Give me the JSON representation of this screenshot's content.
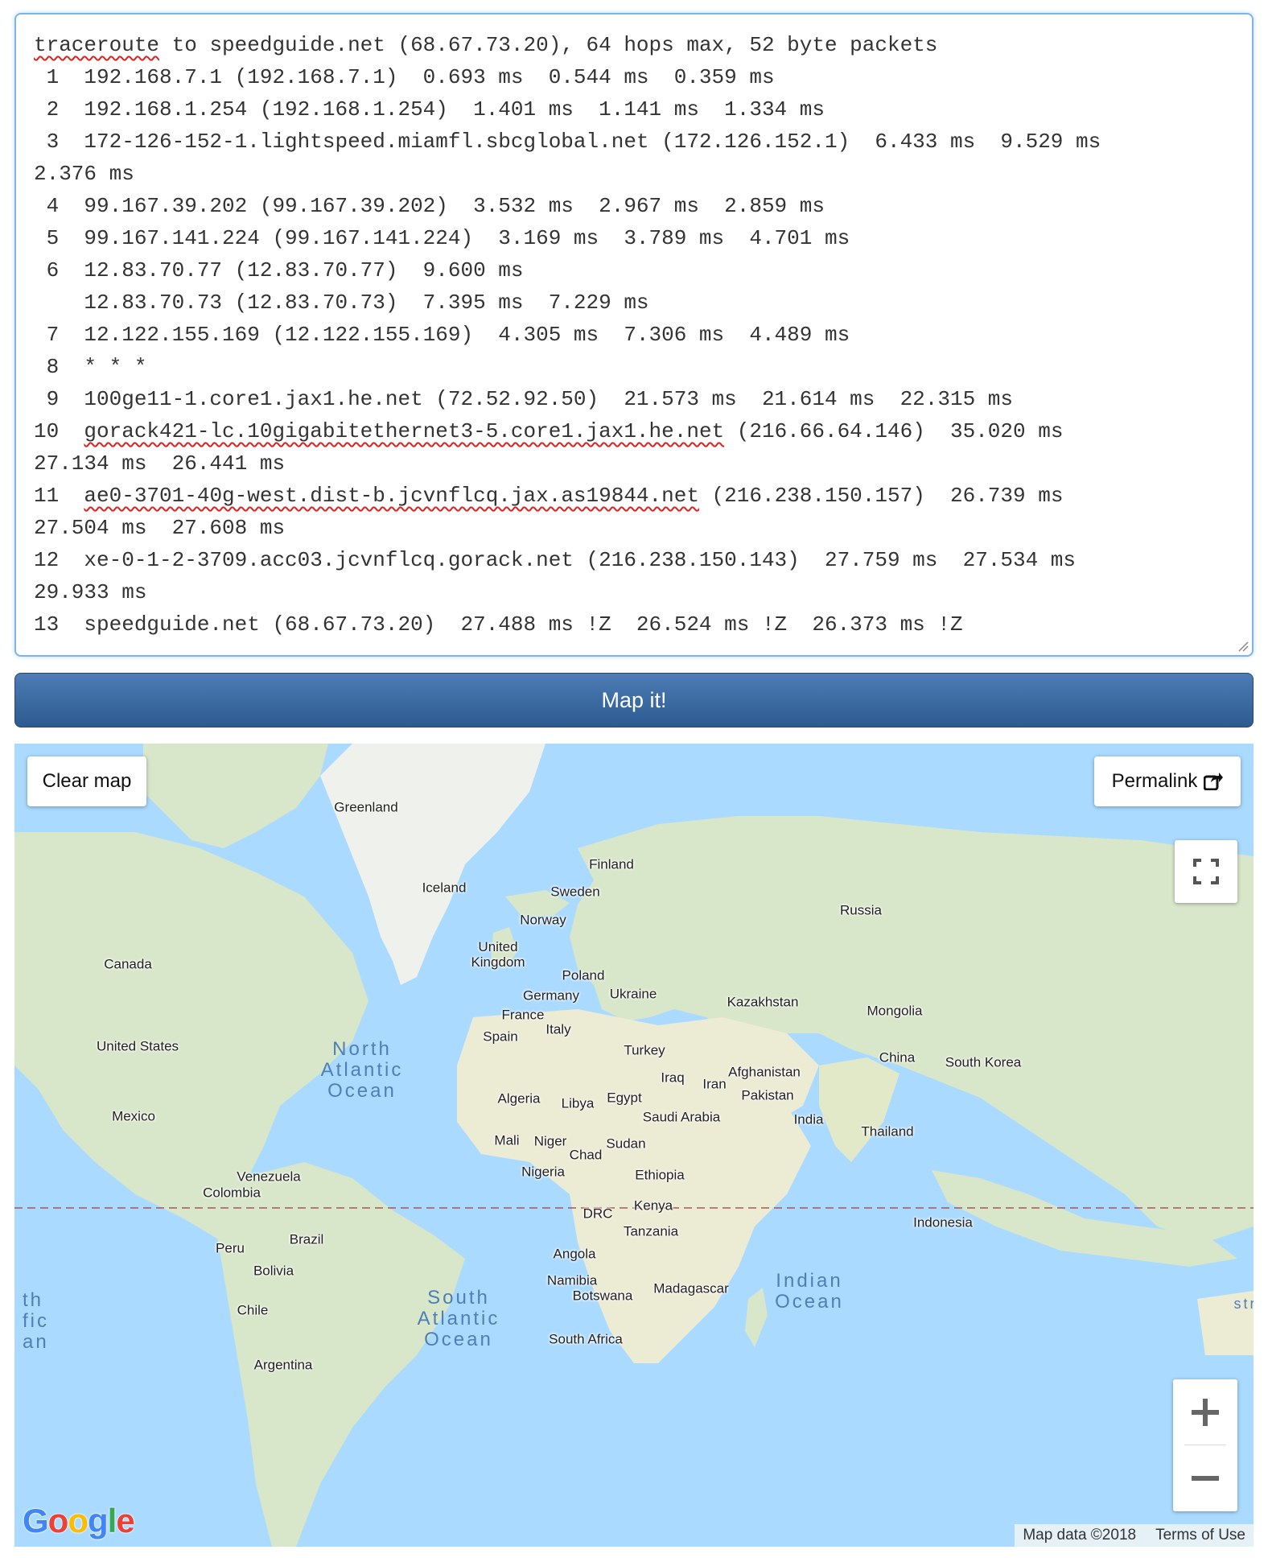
{
  "traceroute": {
    "lines": [
      {
        "lead": "",
        "squiggle": "traceroute",
        "tail": " to speedguide.net (68.67.73.20), 64 hops max, 52 byte packets"
      },
      {
        "lead": "",
        "squiggle": "",
        "tail": " 1  192.168.7.1 (192.168.7.1)  0.693 ms  0.544 ms  0.359 ms"
      },
      {
        "lead": "",
        "squiggle": "",
        "tail": " 2  192.168.1.254 (192.168.1.254)  1.401 ms  1.141 ms  1.334 ms"
      },
      {
        "lead": "",
        "squiggle": "",
        "tail": " 3  172-126-152-1.lightspeed.miamfl.sbcglobal.net (172.126.152.1)  6.433 ms  9.529 ms"
      },
      {
        "lead": "",
        "squiggle": "",
        "tail": "2.376 ms"
      },
      {
        "lead": "",
        "squiggle": "",
        "tail": " 4  99.167.39.202 (99.167.39.202)  3.532 ms  2.967 ms  2.859 ms"
      },
      {
        "lead": "",
        "squiggle": "",
        "tail": " 5  99.167.141.224 (99.167.141.224)  3.169 ms  3.789 ms  4.701 ms"
      },
      {
        "lead": "",
        "squiggle": "",
        "tail": " 6  12.83.70.77 (12.83.70.77)  9.600 ms"
      },
      {
        "lead": "",
        "squiggle": "",
        "tail": "    12.83.70.73 (12.83.70.73)  7.395 ms  7.229 ms"
      },
      {
        "lead": "",
        "squiggle": "",
        "tail": " 7  12.122.155.169 (12.122.155.169)  4.305 ms  7.306 ms  4.489 ms"
      },
      {
        "lead": "",
        "squiggle": "",
        "tail": " 8  * * *"
      },
      {
        "lead": "",
        "squiggle": "",
        "tail": " 9  100ge11-1.core1.jax1.he.net (72.52.92.50)  21.573 ms  21.614 ms  22.315 ms"
      },
      {
        "lead": "10  ",
        "squiggle": "gorack421-lc.10gigabitethernet3-5.core1.jax1.he.net",
        "tail": " (216.66.64.146)  35.020 ms"
      },
      {
        "lead": "",
        "squiggle": "",
        "tail": "27.134 ms  26.441 ms"
      },
      {
        "lead": "11  ",
        "squiggle": "ae0-3701-40g-west.dist-b.jcvnflcq.jax.as19844.net",
        "tail": " (216.238.150.157)  26.739 ms"
      },
      {
        "lead": "",
        "squiggle": "",
        "tail": "27.504 ms  27.608 ms"
      },
      {
        "lead": "",
        "squiggle": "",
        "tail": "12  xe-0-1-2-3709.acc03.jcvnflcq.gorack.net (216.238.150.143)  27.759 ms  27.534 ms"
      },
      {
        "lead": "",
        "squiggle": "",
        "tail": "29.933 ms"
      },
      {
        "lead": "",
        "squiggle": "",
        "tail": "13  speedguide.net (68.67.73.20)  27.488 ms !Z  26.524 ms !Z  26.373 ms !Z"
      }
    ]
  },
  "map_button_label": "Map it!",
  "map": {
    "clear_label": "Clear map",
    "permalink_label": "Permalink",
    "zoom_in_label": "+",
    "zoom_out_label": "−",
    "attribution_data": "Map data ©2018",
    "attribution_terms": "Terms of Use",
    "google_logo": "Google",
    "colors": {
      "water": "#aadaff",
      "land": "#d9e8c4",
      "equator": "#a05050"
    },
    "place_labels": [
      "Greenland",
      "Iceland",
      "Finland",
      "Sweden",
      "Norway",
      "Russia",
      "United\nKingdom",
      "Poland",
      "Germany",
      "Ukraine",
      "France",
      "Kazakhstan",
      "Mongolia",
      "Spain",
      "Italy",
      "Turkey",
      "China",
      "South Korea",
      "Afghanistan",
      "Iraq",
      "Iran",
      "Pakistan",
      "Algeria",
      "Libya",
      "Egypt",
      "Saudi Arabia",
      "India",
      "Thailand",
      "Mali",
      "Niger",
      "Chad",
      "Sudan",
      "Nigeria",
      "Ethiopia",
      "Kenya",
      "DRC",
      "Tanzania",
      "Indonesia",
      "Angola",
      "Namibia",
      "Botswana",
      "Madagascar",
      "South Africa",
      "Canada",
      "United States",
      "Mexico",
      "Venezuela",
      "Colombia",
      "Brazil",
      "Peru",
      "Bolivia",
      "Chile",
      "Argentina"
    ],
    "ocean_labels": [
      "North\nAtlantic\nOcean",
      "South\nAtlantic\nOcean",
      "Indian\nOcean",
      "th\nfic\nan",
      "str"
    ]
  }
}
